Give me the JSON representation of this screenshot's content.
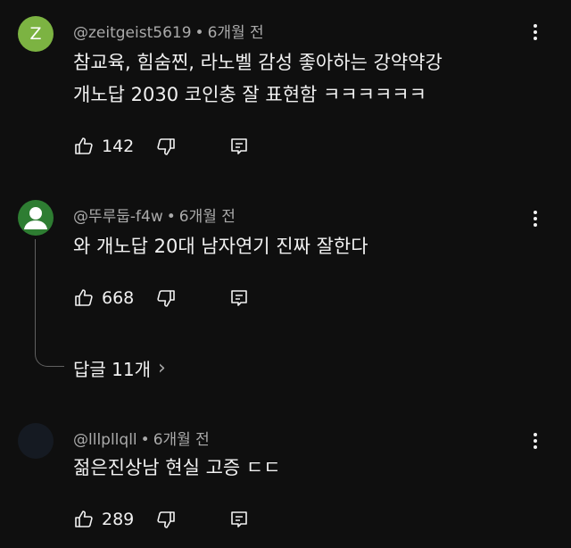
{
  "comments": [
    {
      "avatar_letter": "Z",
      "avatar_color": "#7cb342",
      "author": "@zeitgeist5619",
      "separator": "•",
      "time": "6개월 전",
      "text_line1": "참교육, 힘숨찐, 라노벨 감성 좋아하는 강약약강",
      "text_line2": "개노답 2030 코인충 잘 표현함 ㅋㅋㅋㅋㅋㅋ",
      "likes": "142",
      "icons": [
        "like-icon",
        "dislike-icon",
        "reply-icon",
        "more-icon"
      ]
    },
    {
      "avatar_color": "#2e7d32",
      "author": "@뚜루둡-f4w",
      "separator": "•",
      "time": "6개월 전",
      "text_line1": "와 개노답 20대 남자연기 진짜 잘한다",
      "likes": "668",
      "replies_label": "답글 11개",
      "replies_chevron": "›",
      "icons": [
        "like-icon",
        "dislike-icon",
        "reply-icon",
        "more-icon",
        "chevron-right-icon"
      ]
    },
    {
      "avatar_color": "#151a22",
      "author": "@lllpllqll",
      "separator": "•",
      "time": "6개월 전",
      "text_line1": "젊은진상남 현실 고증 ㄷㄷ",
      "likes": "289",
      "icons": [
        "like-icon",
        "dislike-icon",
        "reply-icon",
        "more-icon"
      ]
    }
  ]
}
